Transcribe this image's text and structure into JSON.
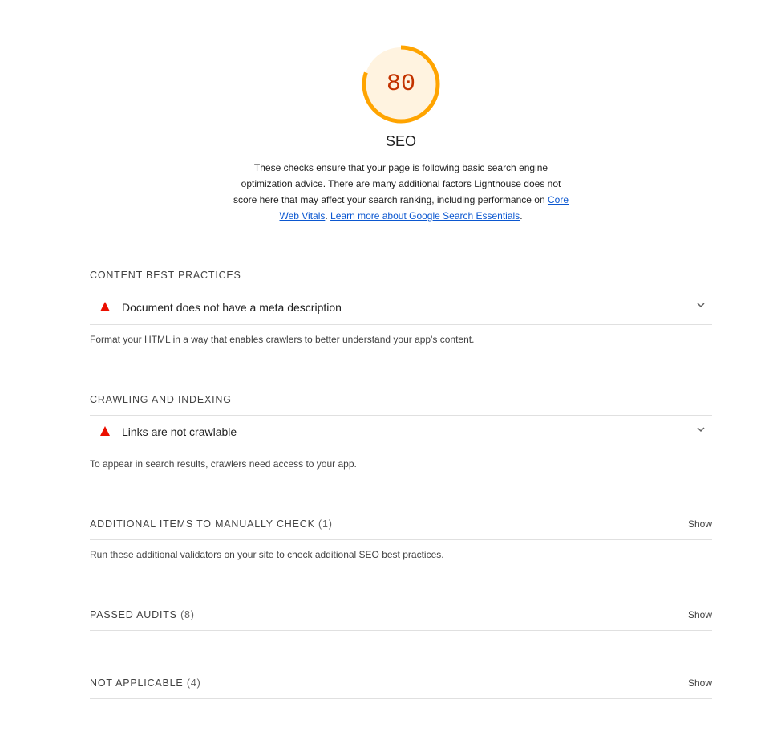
{
  "gauge": {
    "score": "80",
    "score_fraction": 0.8,
    "title": "SEO",
    "colors": {
      "ring": "#ffa400",
      "fill": "#fff3e0",
      "text": "#c33300"
    }
  },
  "description": {
    "text": "These checks ensure that your page is following basic search engine optimization advice. There are many additional factors Lighthouse does not score here that may affect your search ranking, including performance on ",
    "link1": "Core Web Vitals",
    "sep": ". ",
    "link2": "Learn more about Google Search Essentials",
    "end": "."
  },
  "groups": {
    "content": {
      "title": "Content Best Practices",
      "audit_title": "Document does not have a meta description",
      "description": "Format your HTML in a way that enables crawlers to better understand your app's content."
    },
    "crawling": {
      "title": "Crawling and Indexing",
      "audit_title": "Links are not crawlable",
      "description": "To appear in search results, crawlers need access to your app."
    },
    "manual": {
      "title": "Additional items to manually check",
      "count": "(1)",
      "show": "Show",
      "description": "Run these additional validators on your site to check additional SEO best practices."
    },
    "passed": {
      "title": "Passed audits",
      "count": "(8)",
      "show": "Show"
    },
    "notapplicable": {
      "title": "Not applicable",
      "count": "(4)",
      "show": "Show"
    }
  },
  "icons": {
    "fail": "fail-triangle-icon",
    "expand": "chevron-down-icon"
  },
  "colors": {
    "fail": "#eb0f00",
    "link": "#0b57d0",
    "divider": "#e0e0e0"
  }
}
